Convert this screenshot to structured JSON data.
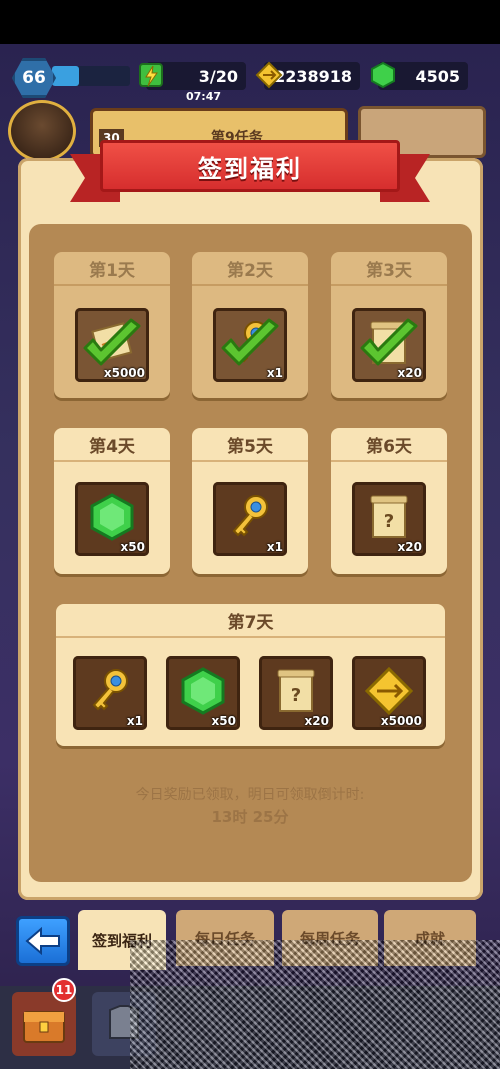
{
  "status": {
    "level": "66",
    "xp_progress": 0.35,
    "energy": "3/20",
    "energy_timer": "07:47",
    "coins": "2238918",
    "gems": "4505"
  },
  "banner": {
    "number": "30",
    "text": "第9任务"
  },
  "modal": {
    "title": "签到福利"
  },
  "days": [
    {
      "label": "第1天",
      "item": "arrow-scroll-icon",
      "qty": "x5000",
      "claimed": true
    },
    {
      "label": "第2天",
      "item": "key-icon",
      "qty": "x1",
      "claimed": true
    },
    {
      "label": "第3天",
      "item": "mystery-scroll-icon",
      "qty": "x20",
      "claimed": true
    },
    {
      "label": "第4天",
      "item": "green-gem-icon",
      "qty": "x50",
      "claimed": false
    },
    {
      "label": "第5天",
      "item": "key-icon",
      "qty": "x1",
      "claimed": false
    },
    {
      "label": "第6天",
      "item": "mystery-scroll-icon",
      "qty": "x20",
      "claimed": false
    }
  ],
  "day7": {
    "label": "第7天",
    "items": [
      {
        "item": "key-icon",
        "qty": "x1"
      },
      {
        "item": "green-gem-icon",
        "qty": "x50"
      },
      {
        "item": "mystery-scroll-icon",
        "qty": "x20"
      },
      {
        "item": "arrow-token-icon",
        "qty": "x5000"
      }
    ]
  },
  "info": {
    "message": "今日奖励已领取，明日可领取倒计时:",
    "countdown": "13时 25分"
  },
  "tabs": [
    {
      "label": "签到福利",
      "active": true
    },
    {
      "label": "每日任务",
      "active": false
    },
    {
      "label": "每周任务",
      "active": false
    },
    {
      "label": "成就",
      "active": false
    }
  ],
  "bottom_nav": {
    "chest_badge": "11"
  },
  "colors": {
    "ribbon": "#d62e2e",
    "panel": "#b48954",
    "card": "#f8e3b5",
    "check": "#5cc530"
  }
}
